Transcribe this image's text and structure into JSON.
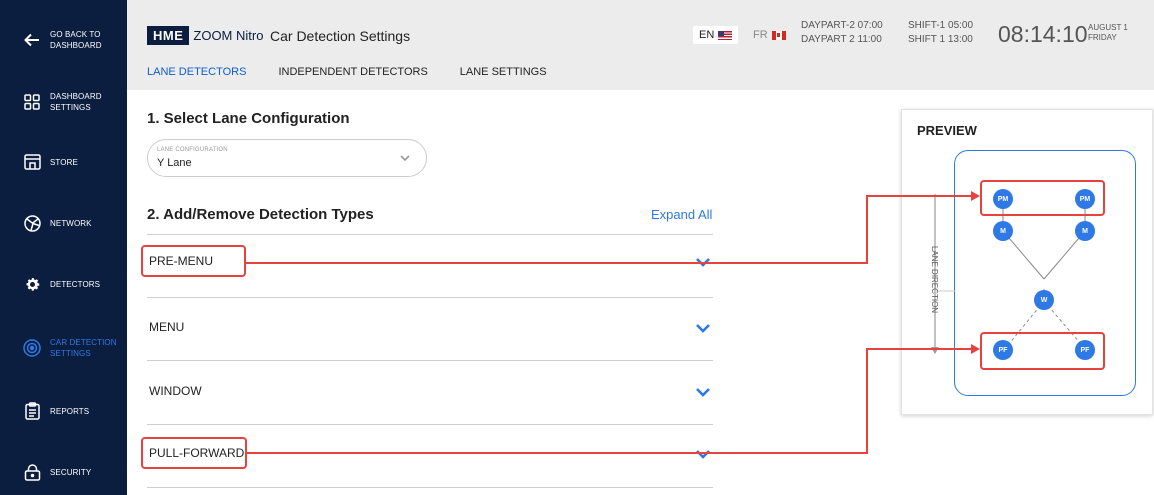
{
  "sidebar": {
    "items": [
      {
        "label": "GO BACK TO DASHBOARD",
        "icon": "arrow-left-icon"
      },
      {
        "label": "DASHBOARD SETTINGS",
        "icon": "dashboard-grid-icon"
      },
      {
        "label": "STORE",
        "icon": "store-icon"
      },
      {
        "label": "NETWORK",
        "icon": "network-icon"
      },
      {
        "label": "DETECTORS",
        "icon": "gear-icon"
      },
      {
        "label": "CAR DETECTION SETTINGS",
        "icon": "car-detection-icon",
        "active": true
      },
      {
        "label": "REPORTS",
        "icon": "clipboard-icon"
      },
      {
        "label": "SECURITY",
        "icon": "lock-icon"
      }
    ]
  },
  "header": {
    "logo_badge": "HME",
    "logo_text": "ZOOM Nitro",
    "title": "Car Detection Settings",
    "tabs": [
      {
        "label": "LANE DETECTORS",
        "active": true
      },
      {
        "label": "INDEPENDENT DETECTORS"
      },
      {
        "label": "LANE SETTINGS"
      }
    ],
    "lang_en": "EN",
    "lang_fr": "FR",
    "schedule_col1": [
      "DAYPART-2 07:00",
      "DAYPART 2 11:00"
    ],
    "schedule_col2": [
      "SHIFT-1 05:00",
      "SHIFT 1 13:00"
    ],
    "clock": "08:14:10",
    "date_line1": "AUGUST 1",
    "date_line2": "FRIDAY"
  },
  "main": {
    "section1_title": "1. Select Lane Configuration",
    "lane_config": {
      "label": "LANE CONFIGURATION",
      "value": "Y Lane"
    },
    "section2_title": "2. Add/Remove Detection Types",
    "expand_all": "Expand All",
    "detection_types": [
      {
        "label": "PRE-MENU",
        "highlighted": true
      },
      {
        "label": "MENU",
        "highlighted": false
      },
      {
        "label": "WINDOW",
        "highlighted": false
      },
      {
        "label": "PULL-FORWARD",
        "highlighted": true
      }
    ]
  },
  "preview": {
    "title": "PREVIEW",
    "lane_direction": "LANE DIRECTION",
    "nodes": {
      "pm": "PM",
      "m": "M",
      "w": "W",
      "pf": "PF"
    }
  },
  "colors": {
    "sidebar_bg": "#0b1e3f",
    "accent": "#2e79e6",
    "highlight": "#e8423f",
    "header_bg": "#ececec"
  }
}
